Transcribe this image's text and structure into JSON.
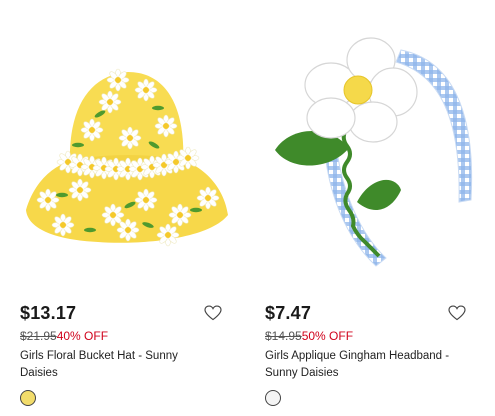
{
  "products": [
    {
      "image_alt": "Girls Floral Bucket Hat - Sunny Daisies",
      "price": "$13.17",
      "original_price": "$21.95",
      "discount": "40% OFF",
      "title": "Girls Floral Bucket Hat - Sunny Daisies",
      "swatch_color": "#f2dc6b",
      "favorite_icon": "heart-outline-icon"
    },
    {
      "image_alt": "Girls Applique Gingham Headband - Sunny Daisies",
      "price": "$7.47",
      "original_price": "$14.95",
      "discount": "50% OFF",
      "title": "Girls Applique Gingham Headband - Sunny Daisies",
      "swatch_color": "#f4f4f4",
      "favorite_icon": "heart-outline-icon"
    }
  ],
  "colors": {
    "sale_red": "#d0021b",
    "hat_yellow": "#f7d84a",
    "gingham_blue": "#6f9fe0",
    "leaf_green": "#3f8a2a"
  }
}
